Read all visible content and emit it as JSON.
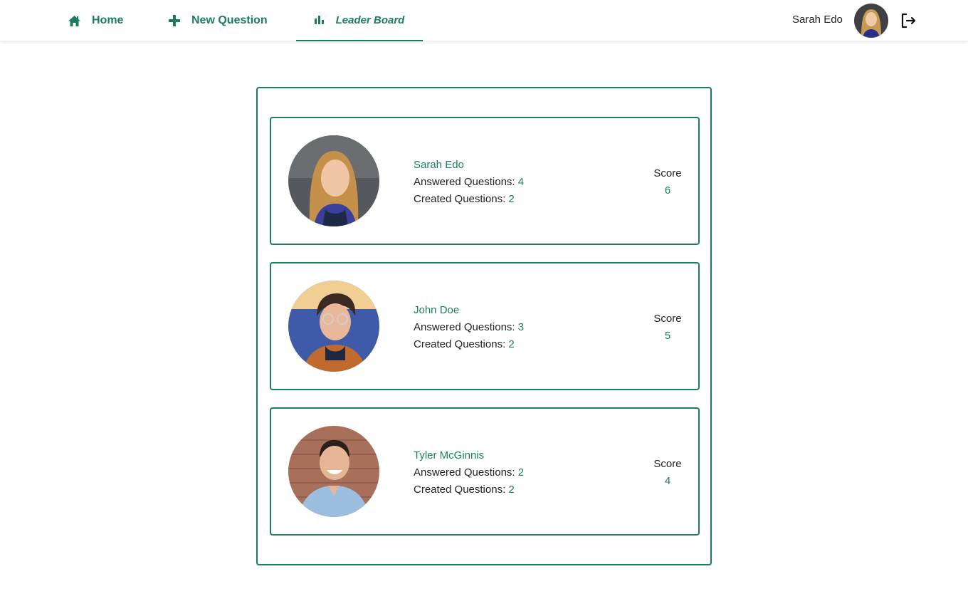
{
  "nav": {
    "home": "Home",
    "new_question": "New Question",
    "leader_board": "Leader Board"
  },
  "user": {
    "name": "Sarah Edo"
  },
  "icons": {
    "home": "home-icon",
    "new_question": "plus-icon",
    "leader_board": "bar-chart-icon",
    "logout": "logout-icon"
  },
  "colors": {
    "accent": "#1c7c62",
    "text": "#222222"
  },
  "leaderboard": [
    {
      "name": "Sarah Edo",
      "answered_label": "Answered Questions: ",
      "answered": "4",
      "created_label": "Created Questions: ",
      "created": "2",
      "score_label": "Score",
      "score": "6"
    },
    {
      "name": "John Doe",
      "answered_label": "Answered Questions: ",
      "answered": "3",
      "created_label": "Created Questions: ",
      "created": "2",
      "score_label": "Score",
      "score": "5"
    },
    {
      "name": "Tyler McGinnis",
      "answered_label": "Answered Questions: ",
      "answered": "2",
      "created_label": "Created Questions: ",
      "created": "2",
      "score_label": "Score",
      "score": "4"
    }
  ]
}
